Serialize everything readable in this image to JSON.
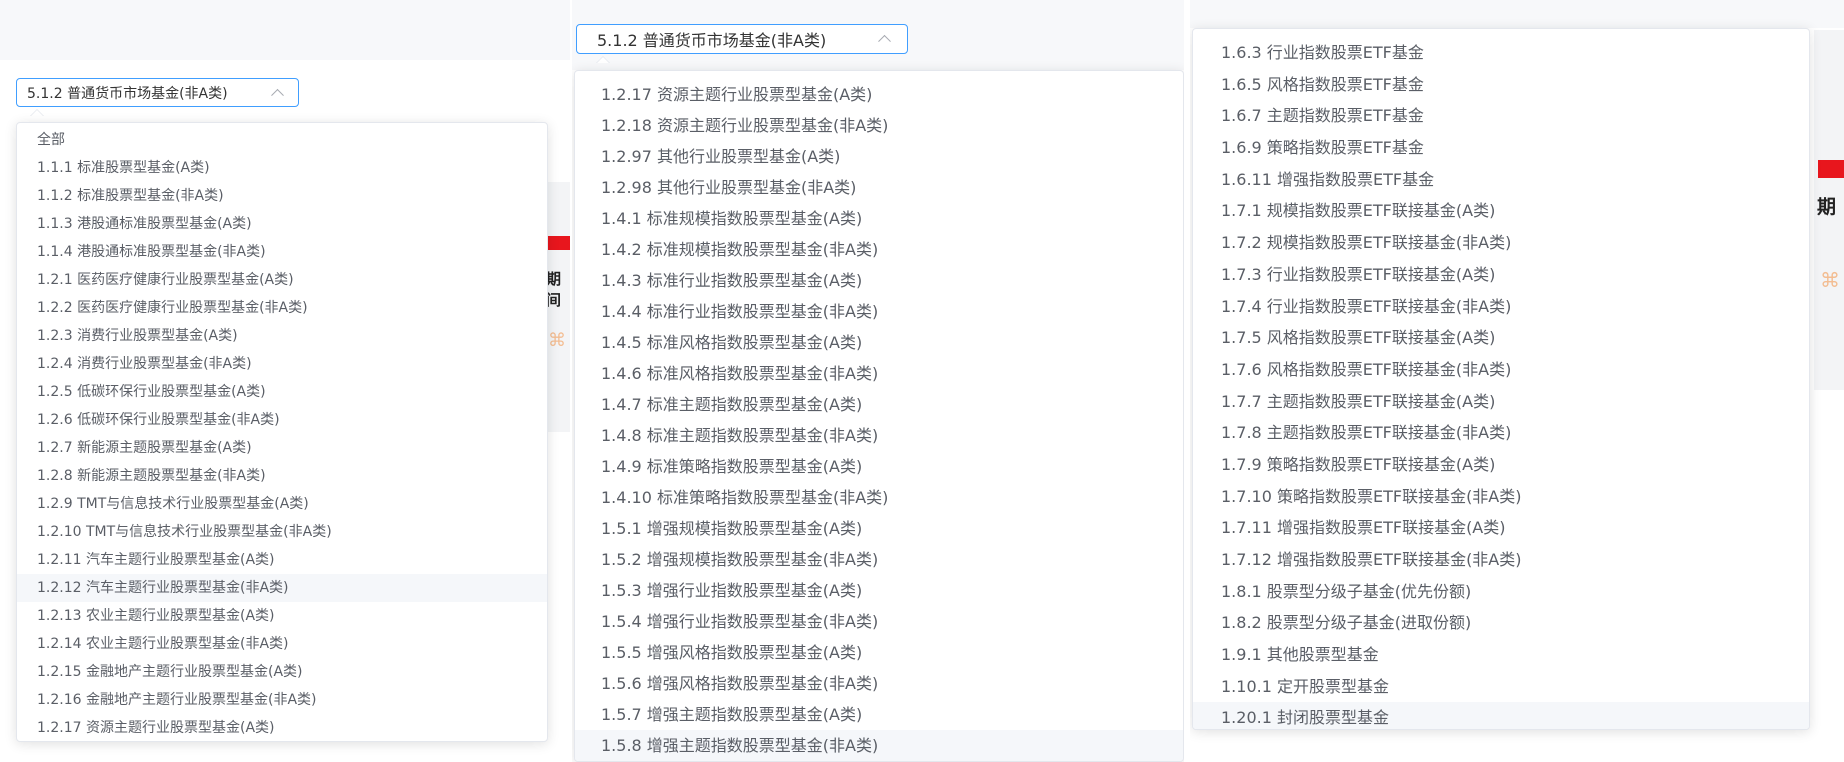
{
  "colors": {
    "accent": "#409eff",
    "header_red": "#e8161d",
    "hover": "#f5f7fa"
  },
  "panel1": {
    "select_value": "5.1.2 普通货币市场基金(非A类)",
    "bg_text": "期间",
    "options": [
      "全部",
      "1.1.1 标准股票型基金(A类)",
      "1.1.2 标准股票型基金(非A类)",
      "1.1.3 港股通标准股票型基金(A类)",
      "1.1.4 港股通标准股票型基金(非A类)",
      "1.2.1 医药医疗健康行业股票型基金(A类)",
      "1.2.2 医药医疗健康行业股票型基金(非A类)",
      "1.2.3 消费行业股票型基金(A类)",
      "1.2.4 消费行业股票型基金(非A类)",
      "1.2.5 低碳环保行业股票型基金(A类)",
      "1.2.6 低碳环保行业股票型基金(非A类)",
      "1.2.7 新能源主题股票型基金(A类)",
      "1.2.8 新能源主题股票型基金(非A类)",
      "1.2.9 TMT与信息技术行业股票型基金(A类)",
      "1.2.10 TMT与信息技术行业股票型基金(非A类)",
      "1.2.11 汽车主题行业股票型基金(A类)",
      "1.2.12 汽车主题行业股票型基金(非A类)",
      "1.2.13 农业主题行业股票型基金(A类)",
      "1.2.14 农业主题行业股票型基金(非A类)",
      "1.2.15 金融地产主题行业股票型基金(A类)",
      "1.2.16 金融地产主题行业股票型基金(非A类)",
      "1.2.17 资源主题行业股票型基金(A类)"
    ]
  },
  "panel2": {
    "select_value": "5.1.2 普通货币市场基金(非A类)",
    "options": [
      "1.2.17 资源主题行业股票型基金(A类)",
      "1.2.18 资源主题行业股票型基金(非A类)",
      "1.2.97 其他行业股票型基金(A类)",
      "1.2.98 其他行业股票型基金(非A类)",
      "1.4.1 标准规模指数股票型基金(A类)",
      "1.4.2 标准规模指数股票型基金(非A类)",
      "1.4.3 标准行业指数股票型基金(A类)",
      "1.4.4 标准行业指数股票型基金(非A类)",
      "1.4.5 标准风格指数股票型基金(A类)",
      "1.4.6 标准风格指数股票型基金(非A类)",
      "1.4.7 标准主题指数股票型基金(A类)",
      "1.4.8 标准主题指数股票型基金(非A类)",
      "1.4.9 标准策略指数股票型基金(A类)",
      "1.4.10 标准策略指数股票型基金(非A类)",
      "1.5.1 增强规模指数股票型基金(A类)",
      "1.5.2 增强规模指数股票型基金(非A类)",
      "1.5.3 增强行业指数股票型基金(A类)",
      "1.5.4 增强行业指数股票型基金(非A类)",
      "1.5.5 增强风格指数股票型基金(A类)",
      "1.5.6 增强风格指数股票型基金(非A类)",
      "1.5.7 增强主题指数股票型基金(A类)",
      "1.5.8 增强主题指数股票型基金(非A类)"
    ]
  },
  "panel3": {
    "bg_text": "期",
    "options": [
      "1.6.3 行业指数股票ETF基金",
      "1.6.5 风格指数股票ETF基金",
      "1.6.7 主题指数股票ETF基金",
      "1.6.9 策略指数股票ETF基金",
      "1.6.11 增强指数股票ETF基金",
      "1.7.1 规模指数股票ETF联接基金(A类)",
      "1.7.2 规模指数股票ETF联接基金(非A类)",
      "1.7.3 行业指数股票ETF联接基金(A类)",
      "1.7.4 行业指数股票ETF联接基金(非A类)",
      "1.7.5 风格指数股票ETF联接基金(A类)",
      "1.7.6 风格指数股票ETF联接基金(非A类)",
      "1.7.7 主题指数股票ETF联接基金(A类)",
      "1.7.8 主题指数股票ETF联接基金(非A类)",
      "1.7.9 策略指数股票ETF联接基金(A类)",
      "1.7.10 策略指数股票ETF联接基金(非A类)",
      "1.7.11 增强指数股票ETF联接基金(A类)",
      "1.7.12 增强指数股票ETF联接基金(非A类)",
      "1.8.1 股票型分级子基金(优先份额)",
      "1.8.2 股票型分级子基金(进取份额)",
      "1.9.1 其他股票型基金",
      "1.10.1 定开股票型基金",
      "1.20.1 封闭股票型基金"
    ]
  }
}
